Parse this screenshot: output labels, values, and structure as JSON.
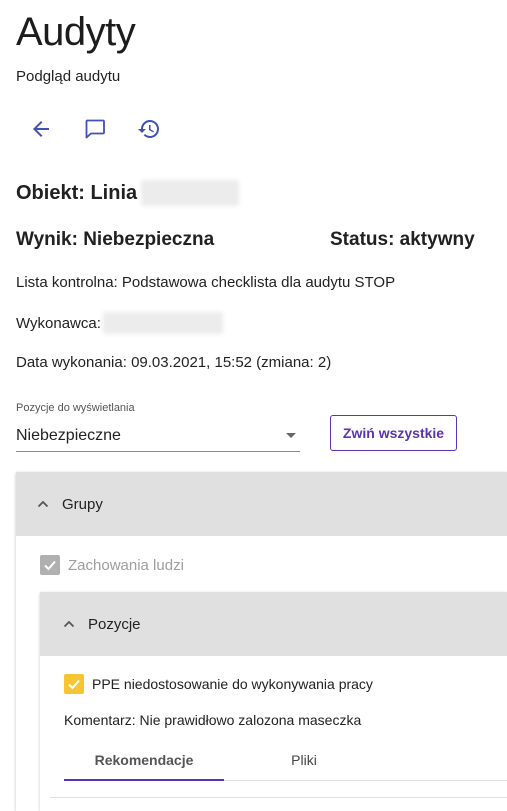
{
  "header": {
    "title": "Audyty",
    "subtitle": "Podgląd audytu"
  },
  "toolbar": {
    "back_icon": "arrow-left-icon",
    "comment_icon": "comment-icon",
    "history_icon": "history-icon",
    "accent": "#3f51b5"
  },
  "audit": {
    "obiekt_label": "Obiekt: Linia",
    "wynik": "Wynik: Niebezpieczna",
    "status": "Status: aktywny",
    "lista": "Lista kontrolna: Podstawowa checklista dla audytu STOP",
    "wykonawca_label": "Wykonawca:",
    "data": "Data wykonania: 09.03.2021, 15:52 (zmiana: 2)"
  },
  "filter": {
    "label": "Pozycje do wyświetlania",
    "value": "Niebezpieczne"
  },
  "collapse_button": "Zwiń wszystkie",
  "groups": {
    "title": "Grupy",
    "group_label": "Zachowania ludzi",
    "group_checked": true,
    "positions": {
      "title": "Pozycje",
      "item_label": "PPE niedostosowanie do wykonywania pracy",
      "item_checked": true,
      "comment": "Komentarz: Nie prawidłowo zalozona maseczka",
      "tabs": [
        "Rekomendacje",
        "Pliki"
      ],
      "active_tab": "Rekomendacje"
    }
  },
  "colors": {
    "primary": "#5a34b3",
    "icon_blue": "#3f51b5",
    "check_yellow": "#f7c531",
    "check_grey": "#b0b0b0"
  }
}
